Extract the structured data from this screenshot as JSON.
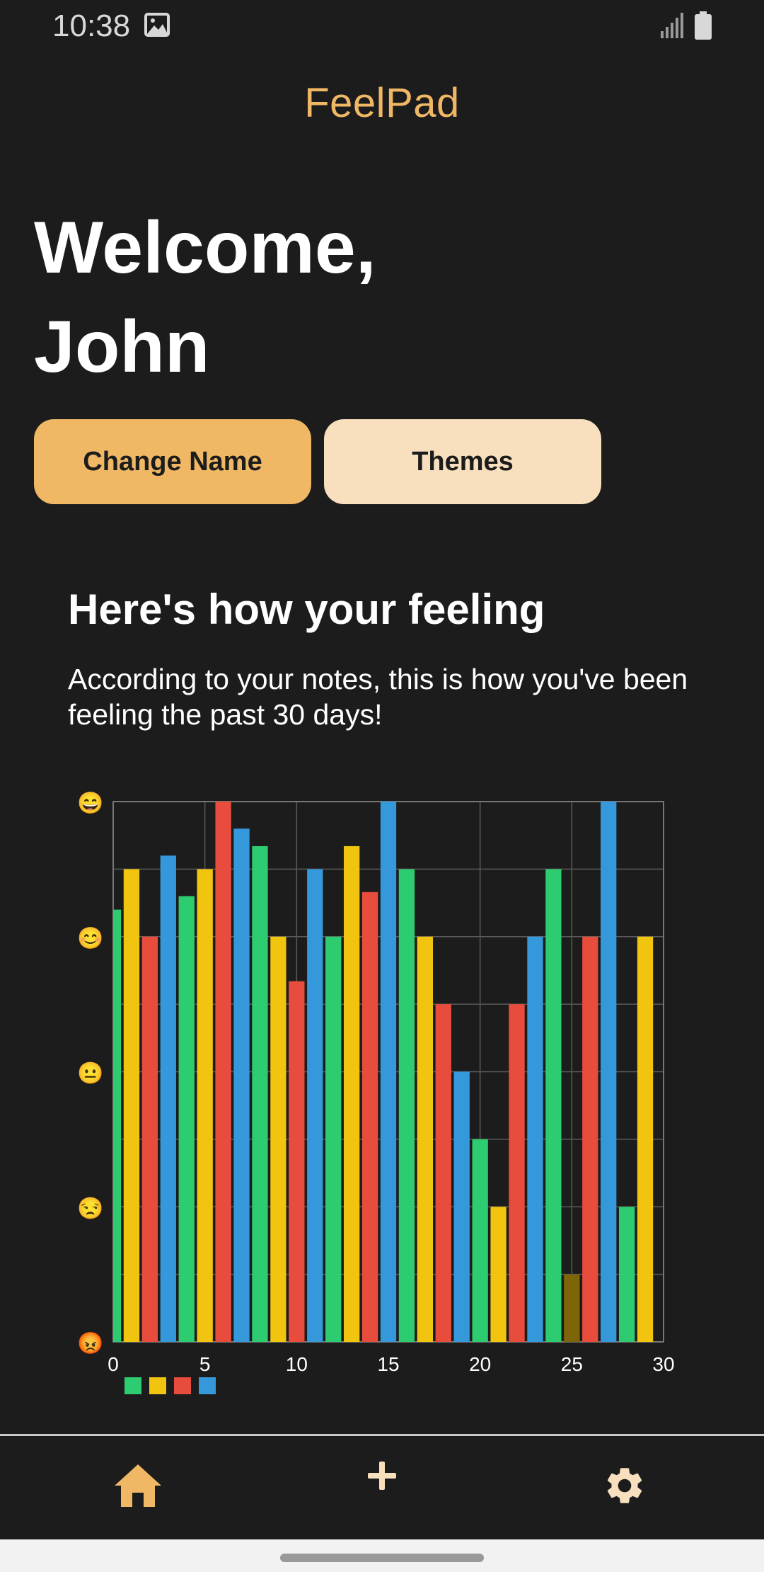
{
  "status_bar": {
    "time": "10:38"
  },
  "app_title": "FeelPad",
  "welcome": {
    "line1": "Welcome,",
    "line2": "John"
  },
  "buttons": {
    "change_name": "Change Name",
    "themes": "Themes"
  },
  "mood_section": {
    "title": "Here's how your feeling",
    "description": "According to your notes, this is how you've been feeling the past 30 days!"
  },
  "colors": {
    "background": "#1c1c1c",
    "accent": "#f0b865",
    "accent_light": "#f8dfbd",
    "green": "#2ecc71",
    "yellow": "#f1c40f",
    "red": "#e74c3c",
    "blue": "#3498db",
    "olive": "#7d6608"
  },
  "chart_data": {
    "type": "bar",
    "x": [
      0,
      1,
      2,
      3,
      4,
      5,
      6,
      7,
      8,
      9,
      10,
      11,
      12,
      13,
      14,
      15,
      16,
      17,
      18,
      19,
      20,
      21,
      22,
      23,
      24,
      25,
      26,
      27,
      28,
      29
    ],
    "values": [
      3.2,
      3.5,
      3.0,
      3.6,
      3.3,
      3.5,
      4.0,
      3.8,
      3.67,
      3.0,
      2.67,
      3.5,
      3.0,
      3.67,
      3.33,
      4.0,
      3.5,
      3.0,
      2.5,
      2.0,
      1.5,
      1.0,
      2.5,
      3.0,
      3.5,
      0.5,
      3.0,
      4.0,
      1.0,
      3.0
    ],
    "bar_colors": [
      "green",
      "yellow",
      "red",
      "blue",
      "green",
      "yellow",
      "red",
      "blue",
      "green",
      "yellow",
      "red",
      "blue",
      "green",
      "yellow",
      "red",
      "blue",
      "green",
      "yellow",
      "red",
      "blue",
      "green",
      "yellow",
      "red",
      "blue",
      "green",
      "olive",
      "red",
      "blue",
      "green",
      "yellow"
    ],
    "xlim": [
      0,
      30
    ],
    "ylim": [
      0,
      4
    ],
    "x_ticks": [
      "0",
      "5",
      "10",
      "15",
      "20",
      "25",
      "30"
    ],
    "y_tick_icons": [
      "angry-face-icon",
      "unamused-face-icon",
      "neutral-face-icon",
      "smiling-face-icon",
      "grinning-face-icon"
    ],
    "y_tick_glyphs": [
      "😡",
      "😒",
      "😐",
      "😊",
      "😄"
    ],
    "legend": {
      "placement": "bottom-left",
      "swatches": [
        "green",
        "yellow",
        "red",
        "blue"
      ]
    },
    "grid": true
  }
}
